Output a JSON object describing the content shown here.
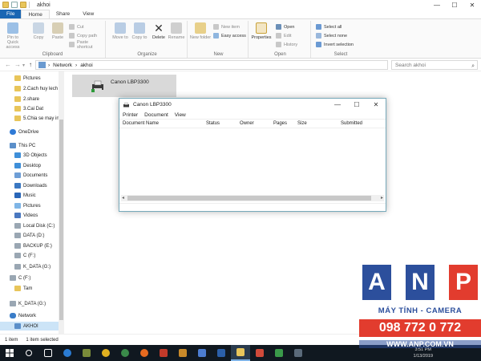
{
  "window": {
    "title": "akhoi",
    "controls": [
      "—",
      "☐",
      "✕"
    ]
  },
  "ribbon_tabs": [
    {
      "label": "File"
    },
    {
      "label": "Home"
    },
    {
      "label": "Share"
    },
    {
      "label": "View"
    }
  ],
  "ribbon": {
    "clipboard": {
      "label": "Clipboard",
      "pin": "Pin to Quick access",
      "copy": "Copy",
      "paste": "Paste",
      "cut": "Cut",
      "copy_path": "Copy path",
      "paste_shortcut": "Paste shortcut"
    },
    "organize": {
      "label": "Organize",
      "move_to": "Move to",
      "copy_to": "Copy to",
      "delete": "Delete",
      "rename": "Rename"
    },
    "new": {
      "label": "New",
      "new_folder": "New folder",
      "new_item": "New item",
      "easy_access": "Easy access"
    },
    "open": {
      "label": "Open",
      "properties": "Properties",
      "open": "Open",
      "edit": "Edit",
      "history": "History"
    },
    "select": {
      "label": "Select",
      "select_all": "Select all",
      "select_none": "Select none",
      "invert": "Invert selection"
    }
  },
  "address": {
    "path": [
      "Network",
      "akhoi"
    ],
    "search_placeholder": "Search akhoi"
  },
  "nav_pane": [
    {
      "label": "Pictures",
      "icon": "folder"
    },
    {
      "label": "2.Cach huy lech",
      "icon": "folder"
    },
    {
      "label": "2.share",
      "icon": "folder"
    },
    {
      "label": "3.Cai Dat",
      "icon": "folder"
    },
    {
      "label": "5.Chia se may in",
      "icon": "folder"
    },
    {
      "label": "OneDrive",
      "icon": "cloud"
    },
    {
      "label": "This PC",
      "icon": "pc"
    },
    {
      "label": "3D Objects",
      "icon": "blue"
    },
    {
      "label": "Desktop",
      "icon": "blue"
    },
    {
      "label": "Documents",
      "icon": "doc"
    },
    {
      "label": "Downloads",
      "icon": "dl"
    },
    {
      "label": "Music",
      "icon": "music"
    },
    {
      "label": "Pictures",
      "icon": "img"
    },
    {
      "label": "Videos",
      "icon": "video"
    },
    {
      "label": "Local Disk (C:)",
      "icon": "drive"
    },
    {
      "label": "DATA (D:)",
      "icon": "drive"
    },
    {
      "label": "BACKUP (E:)",
      "icon": "drive"
    },
    {
      "label": "C (F:)",
      "icon": "drive"
    },
    {
      "label": "K_DATA (G:)",
      "icon": "drive"
    },
    {
      "label": "C (F:)",
      "icon": "drive"
    },
    {
      "label": "Tam",
      "icon": "folder"
    },
    {
      "label": "K_DATA (G:)",
      "icon": "drive"
    },
    {
      "label": "Network",
      "icon": "net"
    },
    {
      "label": "AKHOI",
      "icon": "pc"
    }
  ],
  "content": {
    "printer_name": "Canon LBP3300"
  },
  "dialog": {
    "title": "Canon LBP3300",
    "controls": [
      "—",
      "☐",
      "✕"
    ],
    "menu": [
      "Printer",
      "Document",
      "View"
    ],
    "columns": [
      "Document Name",
      "Status",
      "Owner",
      "Pages",
      "Size",
      "Submitted"
    ]
  },
  "status": {
    "count": "1 item",
    "selected": "1 item selected"
  },
  "taskbar": {
    "time": "3:51 PM",
    "date": "1/13/2019"
  },
  "watermark": {
    "letters": [
      "A",
      "N",
      "P"
    ],
    "slogan": "MÁY TÍNH - CAMERA",
    "phone": "098 772 0 772",
    "website": "WWW.ANP.COM.VN"
  },
  "colors": {
    "file_tab": "#1a66b3",
    "selection": "#cce4f7",
    "taskbar": "#101820",
    "logo_blue": "#2c4f9c",
    "logo_red": "#e23c2e"
  }
}
